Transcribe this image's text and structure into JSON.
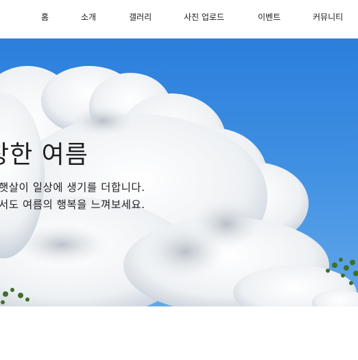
{
  "nav": {
    "items": [
      {
        "label": "홈"
      },
      {
        "label": "소개"
      },
      {
        "label": "갤러리"
      },
      {
        "label": "사진 업로드"
      },
      {
        "label": "이벤트"
      },
      {
        "label": "커뮤니티"
      }
    ]
  },
  "hero": {
    "title": "창한 여름",
    "line1": "햇살이 일상에 생기를 더합니다.",
    "line2": "서도 여름의 행복을 느껴보세요."
  },
  "colors": {
    "sky": "#3e8fe2",
    "cloud": "#f2f4f6",
    "text": "#1f1f1f"
  }
}
